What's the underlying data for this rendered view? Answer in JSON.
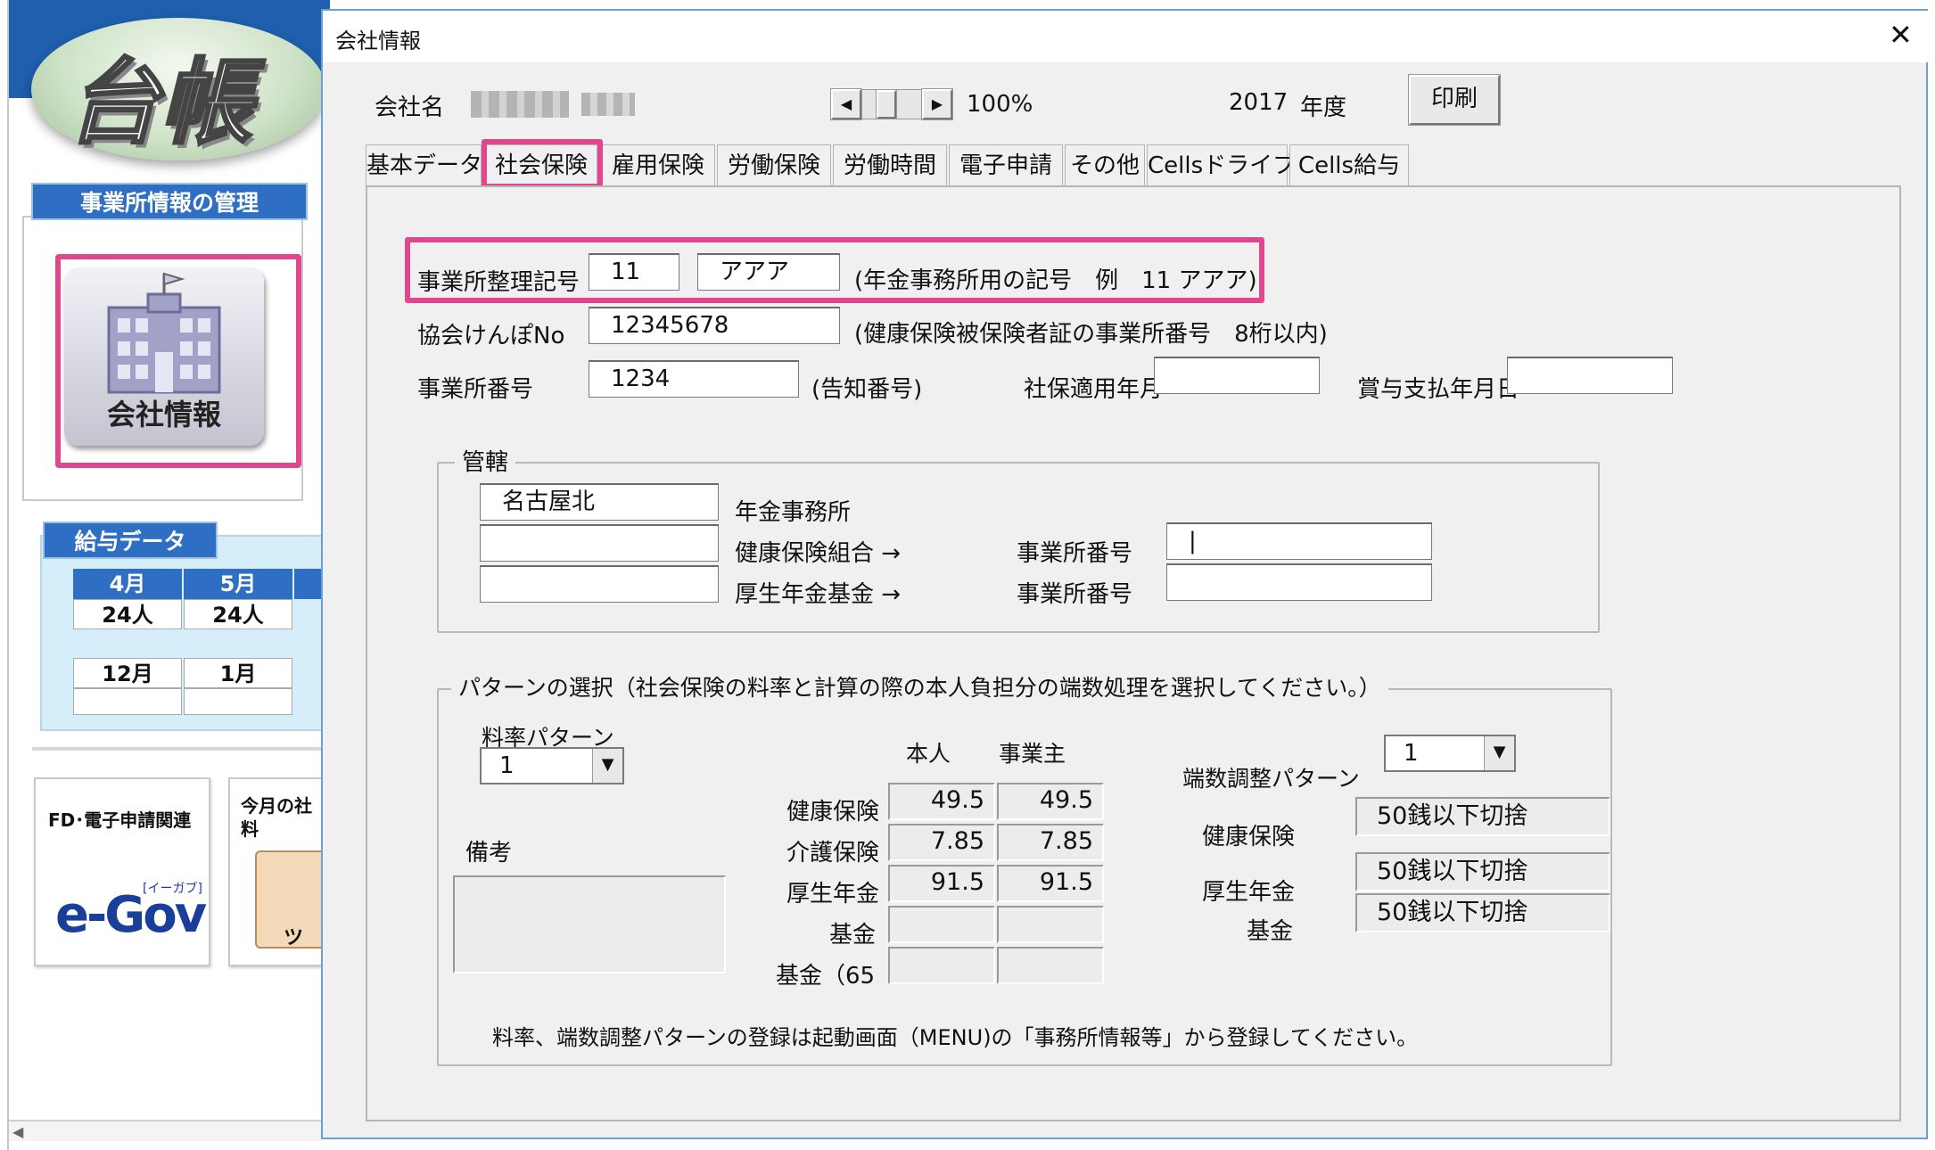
{
  "background_app": {
    "logo_text": "台帳",
    "mgmt_title": "事業所情報の管理",
    "company_button_label": "会社情報",
    "kyuyo_title": "給与データ",
    "months_row1": [
      "4月",
      "5月"
    ],
    "counts_row1": [
      "24人",
      "24人"
    ],
    "months_row2": [
      "12月",
      "1月"
    ],
    "card1_title": "FD･電子申請関連",
    "card1_logo": "e-Gov",
    "card1_logo_sub": "[イーガブ]",
    "card2_title_line1": "今月の社",
    "card2_title_line2": "料",
    "card2_fragment": "ツ"
  },
  "dialog": {
    "title": "会社情報",
    "close_symbol": "✕",
    "company_label": "会社名",
    "zoom": "100%",
    "year": "2017",
    "year_suffix": "年度",
    "print_button": "印刷",
    "tabs": [
      "基本データ",
      "社会保険",
      "雇用保険",
      "労働保険",
      "労働時間",
      "電子申請",
      "その他",
      "Cellsドライブ",
      "Cells給与"
    ],
    "active_tab": "社会保険",
    "office_code_label": "事業所整理記号",
    "office_code_num": "11",
    "office_code_kana": "アアア",
    "office_code_note": "(年金事務所用の記号　例　11 アアア)",
    "kyokai_label": "協会けんぽNo",
    "kyokai_value": "12345678",
    "kyokai_note": "(健康保険被保険者証の事業所番号　8桁以内)",
    "office_no_label": "事業所番号",
    "office_no_value": "1234",
    "office_no_note": "(告知番号)",
    "shaho_label": "社保適用年月",
    "shaho_value": "",
    "bonus_label": "賞与支払年月日",
    "bonus_value": "",
    "kankatsu": {
      "legend": "管轄",
      "pension_office_value": "名古屋北",
      "pension_office_label": "年金事務所",
      "health_union_label": "健康保険組合 →",
      "pension_fund_label": "厚生年金基金 →",
      "office_no_label1": "事業所番号",
      "office_no_label2": "事業所番号",
      "office_no_value1": "|",
      "office_no_value2": ""
    },
    "pattern": {
      "legend": "パターンの選択（社会保険の料率と計算の際の本人負担分の端数処理を選択してください。）",
      "rate_pattern_label": "料率パターン",
      "rate_pattern_value": "1",
      "remarks_label": "備考",
      "col_person": "本人",
      "col_employer": "事業主",
      "rows": [
        {
          "label": "健康保険",
          "person": "49.5",
          "employer": "49.5"
        },
        {
          "label": "介護保険",
          "person": "7.85",
          "employer": "7.85"
        },
        {
          "label": "厚生年金",
          "person": "91.5",
          "employer": "91.5"
        },
        {
          "label": "基金",
          "person": "",
          "employer": ""
        },
        {
          "label": "基金（65",
          "person": "",
          "employer": ""
        }
      ],
      "rounding_pattern_label": "端数調整パターン",
      "rounding_pattern_value": "1",
      "rounding_rows": [
        {
          "label": "健康保険",
          "value": "50銭以下切捨"
        },
        {
          "label": "厚生年金",
          "value": "50銭以下切捨"
        },
        {
          "label": "基金",
          "value": "50銭以下切捨"
        }
      ],
      "footer_note": "料率、端数調整パターンの登録は起動画面（MENU)の「事務所情報等」から登録してください。"
    }
  }
}
